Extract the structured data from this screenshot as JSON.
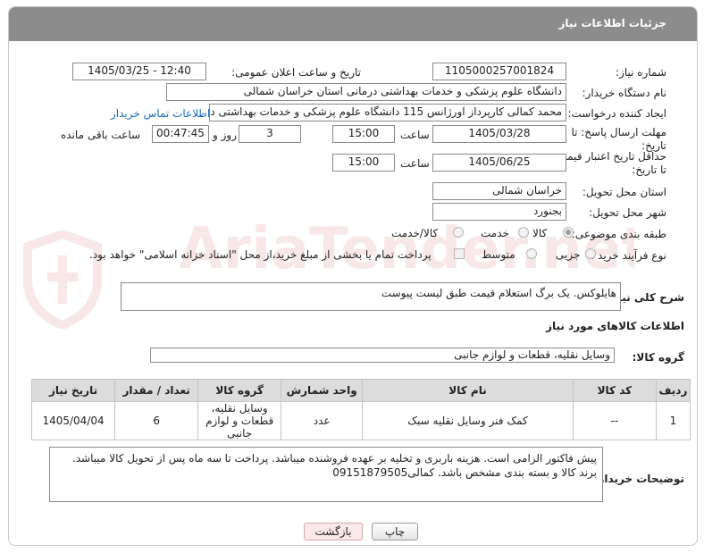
{
  "header": {
    "title": "جزئیات اطلاعات نیاز"
  },
  "form": {
    "need_number_label": "شماره نیاز:",
    "need_number": "1105000257001824",
    "announce_label": "تاریخ و ساعت اعلان عمومی:",
    "announce_value": "1405/03/25 - 12:40",
    "buyer_org_label": "نام دستگاه خریدار:",
    "buyer_org": "دانشگاه علوم پزشکی و خدمات بهداشتی درمانی استان خراسان شمالی",
    "requester_label": "ایجاد کننده درخواست:",
    "requester": "محمد کمالی کارپرداز اورژانس 115 دانشگاه علوم پزشکی و خدمات بهداشتی درمانی",
    "contact_link": "اطلاعات تماس خریدار",
    "reply_deadline_label_1": "مهلت ارسال پاسخ: تا",
    "reply_deadline_label_2": "تاریخ:",
    "reply_date": "1405/03/28",
    "time_label": "ساعت",
    "reply_time": "15:00",
    "days_value": "3",
    "days_label": "روز و",
    "remaining_time": "00:47:45",
    "remaining_label": "ساعت باقی مانده",
    "validity_label_1": "حداقل تاریخ اعتبار قیمت:",
    "validity_label_2": "تا تاریخ:",
    "validity_date": "1405/06/25",
    "validity_time": "15:00",
    "province_label": "استان محل تحویل:",
    "province": "خراسان شمالی",
    "city_label": "شهر محل تحویل:",
    "city": "بجنورد",
    "category_label": "طبقه بندی موضوعی:",
    "category_options": [
      "کالا",
      "خدمت",
      "کالا/خدمت"
    ],
    "category_selected": "کالا",
    "process_label": "نوع فرآیند خرید :",
    "process_options": [
      "جزیی",
      "متوسط"
    ],
    "process_selected": "جزیی",
    "payment_note": "پرداخت تمام یا بخشی از مبلغ خرید،از محل \"اسناد خزانه اسلامی\" خواهد بود."
  },
  "description": {
    "label": "شرح کلی نیاز:",
    "value": "هایلوکس. یک برگ استعلام قیمت طبق لیست پیوست"
  },
  "goods": {
    "section_title": "اطلاعات کالاهای مورد نیاز",
    "group_label": "گروه کالا:",
    "group_value": "وسایل نقلیه، قطعات و لوازم جانبی",
    "columns": [
      "ردیف",
      "کد کالا",
      "نام کالا",
      "واحد شمارش",
      "گروه کالا",
      "تعداد / مقدار",
      "تاریخ نیاز"
    ],
    "rows": [
      {
        "row": "1",
        "code": "--",
        "name": "کمک فنر وسایل نقلیه سبک",
        "unit": "عدد",
        "group": "وسایل نقلیه، قطعات و لوازم جانبی",
        "qty": "6",
        "date": "1405/04/04"
      }
    ]
  },
  "notes": {
    "label": "توضیحات خریدار:",
    "value": "پیش فاکتور الزامی است. هزینه باربری و تخلیه بر عهده فروشنده میباشد. پرداخت تا سه ماه پس از تحویل کالا میباشد. برند کالا و بسته بندی مشخص باشد. کمالی09151879505"
  },
  "buttons": {
    "print": "چاپ",
    "back": "بازگشت"
  },
  "watermark": {
    "text": "AriaTender.net"
  }
}
